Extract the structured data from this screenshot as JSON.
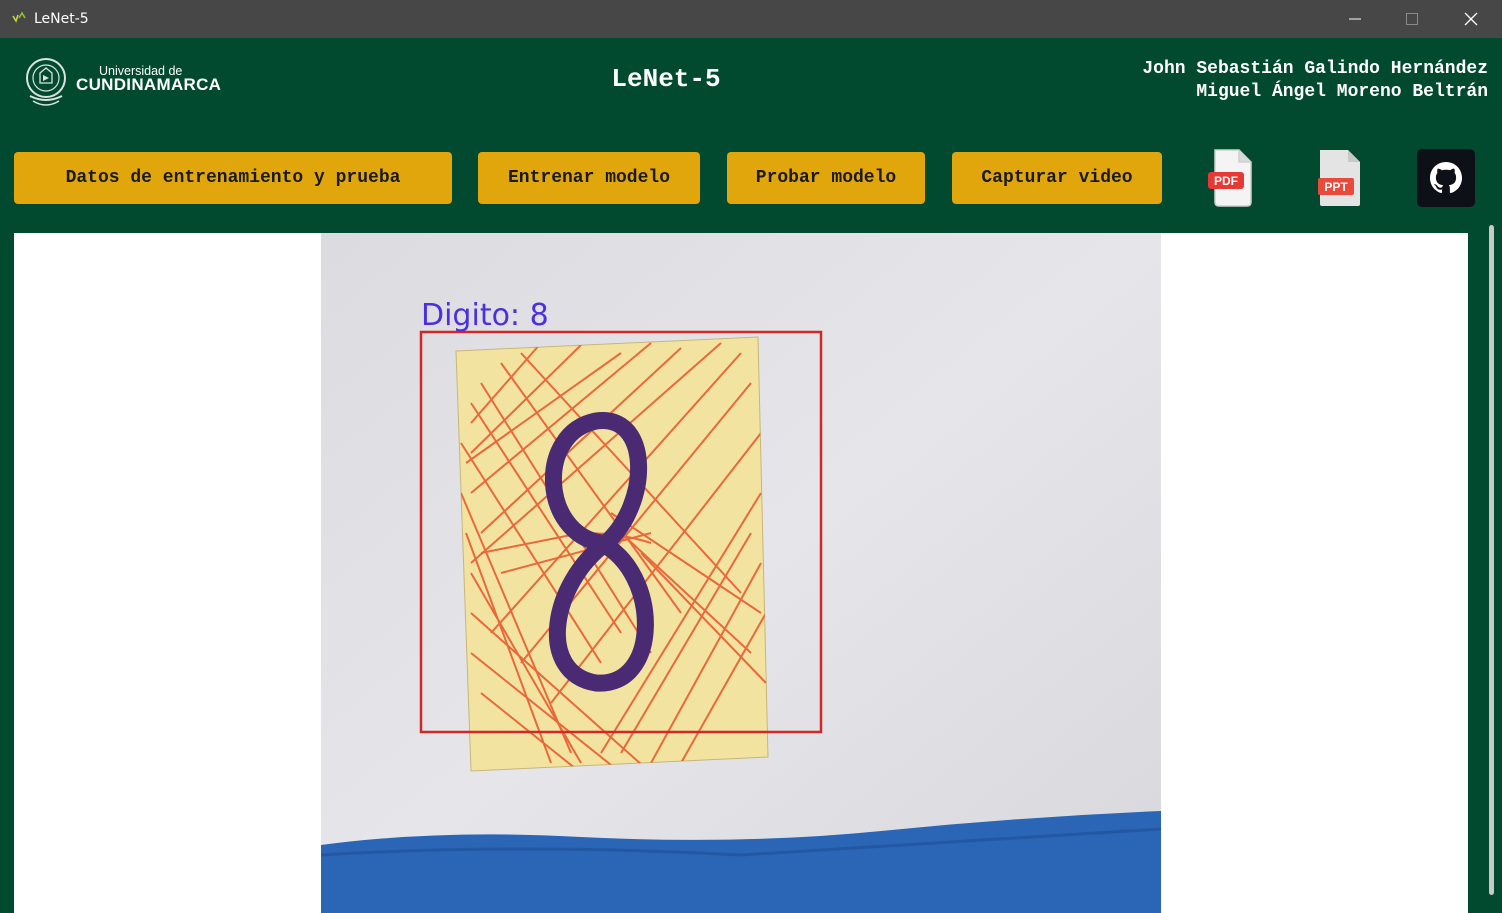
{
  "window": {
    "title": "LeNet-5"
  },
  "header": {
    "university_line1": "Universidad de",
    "university_line2": "CUNDINAMARCA",
    "app_title": "LeNet-5",
    "authors": [
      "John Sebastián Galindo Hernández",
      "Miguel Ángel Moreno Beltrán"
    ]
  },
  "toolbar": {
    "data_button": "Datos de entrenamiento y prueba",
    "train_button": "Entrenar modelo",
    "test_button": "Probar modelo",
    "capture_button": "Capturar video",
    "pdf_label": "PDF",
    "ppt_label": "PPT"
  },
  "camera_view": {
    "prediction_label": "Digito: 8"
  },
  "colors": {
    "header_bg": "#014a2f",
    "button_bg": "#e1a60b",
    "titlebar_bg": "#474747",
    "bbox": "#d02828",
    "prediction_text": "#4b2fe0"
  },
  "icons": [
    "app-icon",
    "university-logo",
    "minimize-icon",
    "maximize-icon",
    "close-icon",
    "pdf-file-icon",
    "ppt-file-icon",
    "github-icon"
  ]
}
